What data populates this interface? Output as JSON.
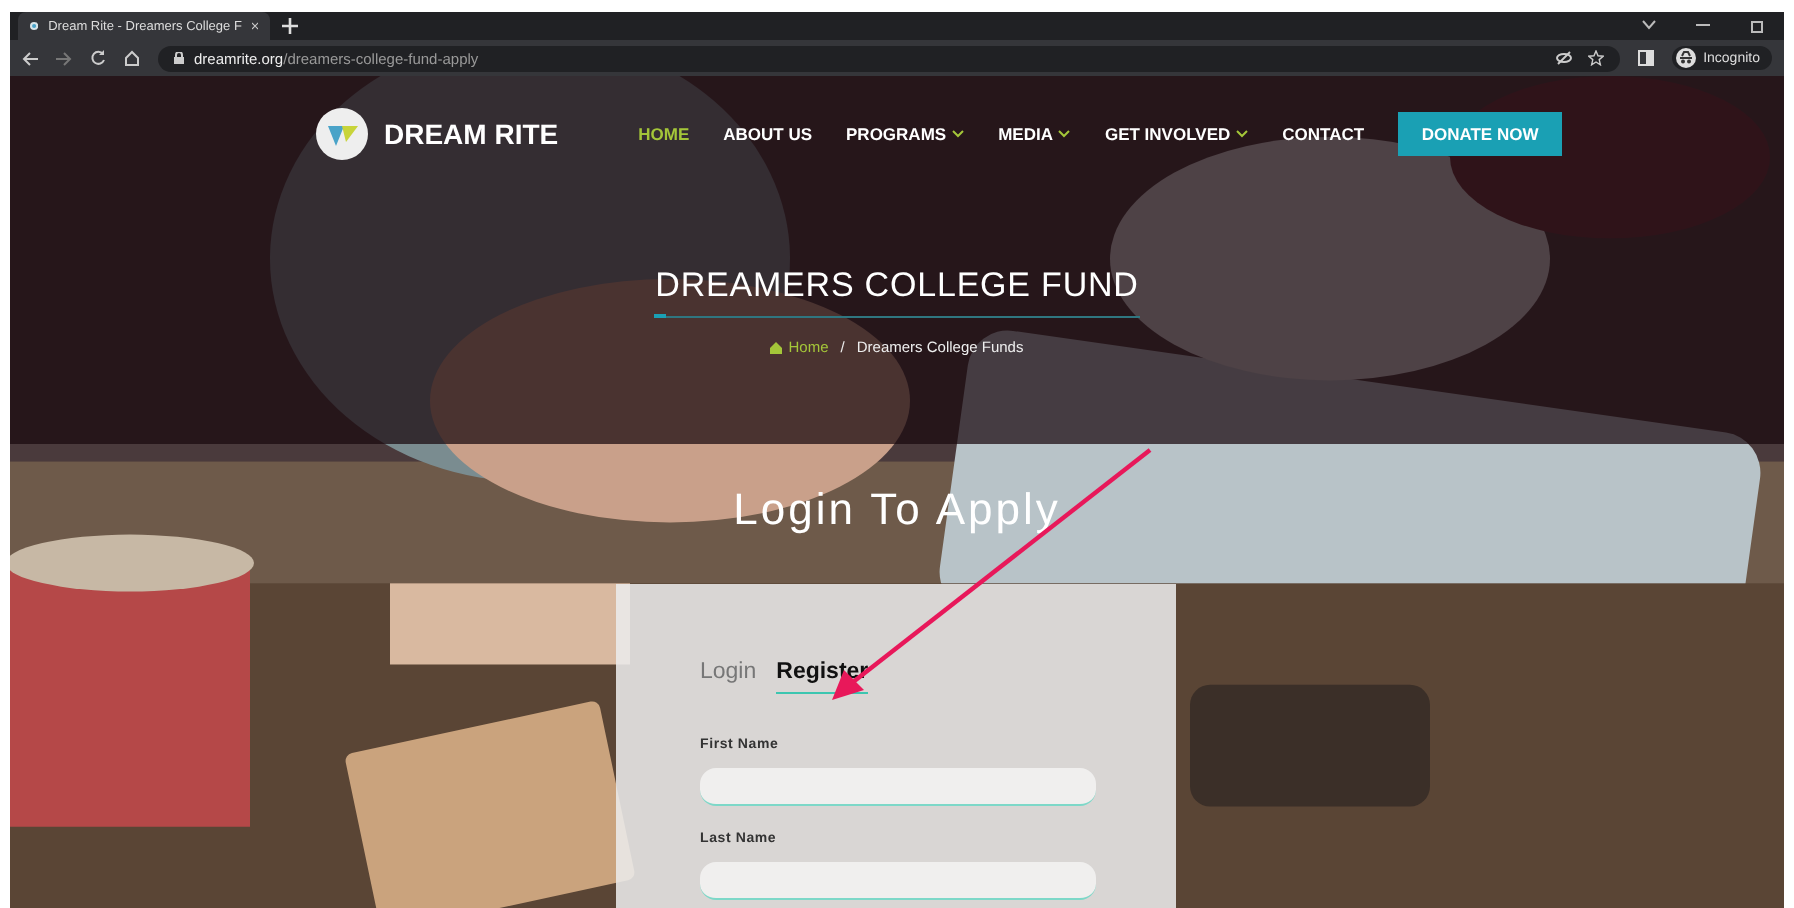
{
  "browser": {
    "tab_title": "Dream Rite - Dreamers College F",
    "url_domain": "dreamrite.org",
    "url_path": "/dreamers-college-fund-apply",
    "profile_label": "Incognito"
  },
  "header": {
    "brand": "DREAM RITE",
    "nav": [
      {
        "label": "HOME",
        "selected": true,
        "dropdown": false
      },
      {
        "label": "ABOUT US",
        "selected": false,
        "dropdown": false
      },
      {
        "label": "PROGRAMS",
        "selected": false,
        "dropdown": true
      },
      {
        "label": "MEDIA",
        "selected": false,
        "dropdown": true
      },
      {
        "label": "GET INVOLVED",
        "selected": false,
        "dropdown": true
      },
      {
        "label": "CONTACT",
        "selected": false,
        "dropdown": false
      }
    ],
    "cta": "DONATE NOW"
  },
  "hero": {
    "title": "DREAMERS COLLEGE FUND",
    "breadcrumb": [
      "Home",
      "Dreamers College Funds"
    ],
    "breadcrumb_separator": "/"
  },
  "form": {
    "title": "Login To Apply",
    "tabs": [
      {
        "label": "Login",
        "selected": false
      },
      {
        "label": "Register",
        "selected": true
      }
    ],
    "fields": [
      {
        "label": "First Name"
      },
      {
        "label": "Last Name"
      }
    ]
  }
}
